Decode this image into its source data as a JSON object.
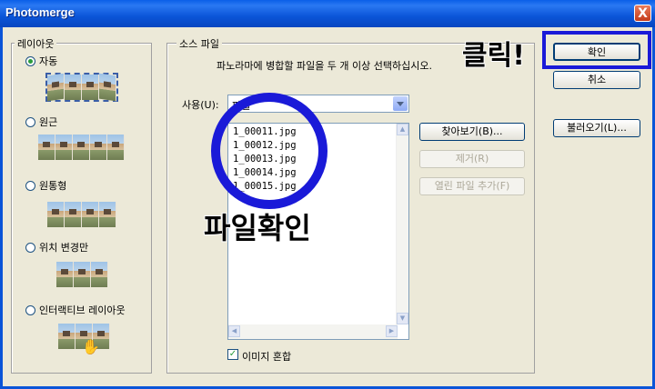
{
  "window": {
    "title": "Photomerge",
    "close_glyph": "X"
  },
  "layout_group": {
    "legend": "레이아웃",
    "options": [
      {
        "label": "자동",
        "selected": true
      },
      {
        "label": "원근",
        "selected": false
      },
      {
        "label": "원통형",
        "selected": false
      },
      {
        "label": "위치 변경만",
        "selected": false
      },
      {
        "label": "인터랙티브 레이아웃",
        "selected": false
      }
    ]
  },
  "source_group": {
    "legend": "소스 파일",
    "instruction": "파노라마에 병합할 파일을 두 개 이상 선택하십시오.",
    "use_label": "사용(U):",
    "use_value": "파일",
    "files": [
      "1_00011.jpg",
      "1_00012.jpg",
      "1_00013.jpg",
      "1_00014.jpg",
      "1_00015.jpg"
    ],
    "browse_button": "찾아보기(B)...",
    "remove_button": "제거(R)",
    "add_open_button": "열린 파일 추가(F)",
    "blend_label": "이미지 혼합",
    "blend_checked": true
  },
  "actions": {
    "ok": "확인",
    "cancel": "취소",
    "load": "불러오기(L)..."
  },
  "annotations": {
    "click_text": "클릭!",
    "check_file_text": "파일확인"
  },
  "colors": {
    "title_bar": "#0b55d8",
    "annotation": "#1a1ad8",
    "dialog_bg": "#ece9d8"
  }
}
